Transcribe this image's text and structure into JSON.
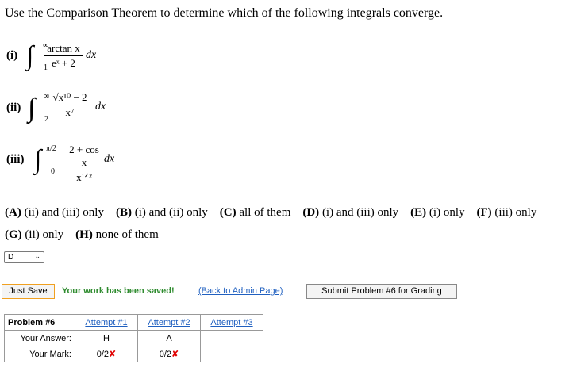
{
  "question": "Use the Comparison Theorem to determine which of the following integrals converge.",
  "integrals": [
    {
      "label": "(i)",
      "upper": "∞",
      "lower": "1",
      "numerator": "arctan x",
      "denominator": "eˣ + 2",
      "dx": "dx"
    },
    {
      "label": "(ii)",
      "upper": "∞",
      "lower": "2",
      "numerator": "√x¹⁰ − 2",
      "denominator": "x⁷",
      "dx": "dx"
    },
    {
      "label": "(iii)",
      "upper": "π/2",
      "lower": "0",
      "numerator": "2 + cos x",
      "denominator": "x¹ᐟ²",
      "dx": "dx"
    }
  ],
  "choices": [
    {
      "key": "(A)",
      "text": "(ii) and (iii) only"
    },
    {
      "key": "(B)",
      "text": "(i) and (ii) only"
    },
    {
      "key": "(C)",
      "text": "all of them"
    },
    {
      "key": "(D)",
      "text": "(i) and (iii) only"
    },
    {
      "key": "(E)",
      "text": "(i) only"
    },
    {
      "key": "(F)",
      "text": "(iii) only"
    },
    {
      "key": "(G)",
      "text": "(ii) only"
    },
    {
      "key": "(H)",
      "text": "none of them"
    }
  ],
  "answer_select": {
    "value": "D",
    "caret": "⌄"
  },
  "buttons": {
    "just_save": "Just Save",
    "submit": "Submit Problem #6 for Grading"
  },
  "status": {
    "saved": "Your work has been saved!",
    "back_link": "(Back to Admin Page)"
  },
  "attempts_table": {
    "header": "Problem #6",
    "attempts": [
      "Attempt #1",
      "Attempt #2",
      "Attempt #3"
    ],
    "answer_label": "Your Answer:",
    "answers": [
      "H",
      "A",
      ""
    ],
    "mark_label": "Your Mark:",
    "marks": [
      "0/2",
      "0/2",
      ""
    ],
    "wrong_mark": "✘"
  }
}
